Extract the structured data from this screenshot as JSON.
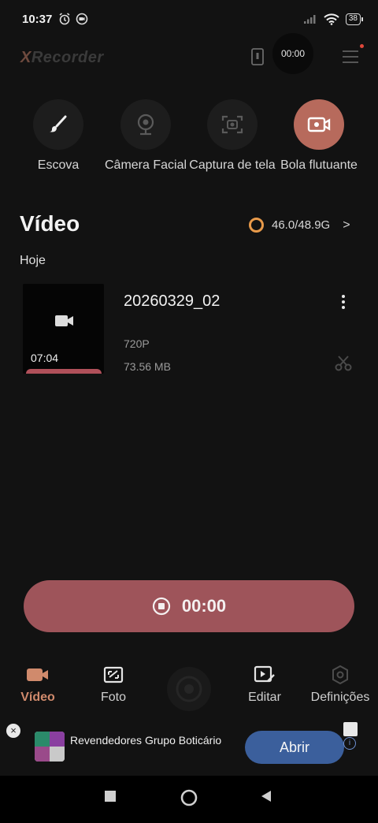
{
  "status_bar": {
    "time": "10:37",
    "battery": "38"
  },
  "app_bar": {
    "logo_x": "X",
    "logo_rest": "Recorder",
    "floating_timer": "00:00"
  },
  "tools": [
    {
      "label": "Escova",
      "icon": "brush-icon"
    },
    {
      "label": "Câmera Facial",
      "icon": "webcam-icon"
    },
    {
      "label": "Captura de tela",
      "icon": "screenshot-icon"
    },
    {
      "label": "Bola flutuante",
      "icon": "video-camera-icon",
      "active": true
    }
  ],
  "section": {
    "title": "Vídeo",
    "storage": "46.0/48.9G"
  },
  "date_group": "Hoje",
  "videos": [
    {
      "name": "20260329_02",
      "duration": "07:04",
      "resolution": "720P",
      "size": "73.56 MB"
    }
  ],
  "record_button": {
    "time": "00:00"
  },
  "bottom_nav": [
    {
      "label": "Vídeo",
      "icon": "video-icon",
      "active": true
    },
    {
      "label": "Foto",
      "icon": "screenshot-frame-icon"
    },
    {
      "label": "",
      "icon": "record-center-icon"
    },
    {
      "label": "Editar",
      "icon": "edit-video-icon"
    },
    {
      "label": "Definições",
      "icon": "settings-icon"
    }
  ],
  "ad": {
    "text": "Revendedores Grupo Boticário",
    "button": "Abrir"
  },
  "colors": {
    "accent": "#b76a5c",
    "record_button": "#9e545a",
    "ad_button": "#3b5f9c",
    "storage_ring": "#e89a4a"
  }
}
